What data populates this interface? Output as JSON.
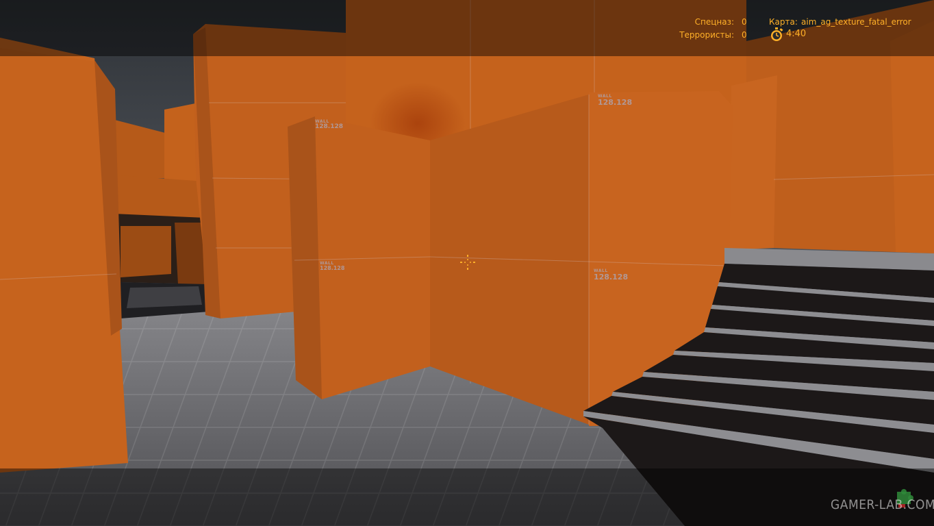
{
  "hud": {
    "ct_label": "Спецназ:",
    "ct_score": "0",
    "t_label": "Террористы:",
    "t_score": "0",
    "map_label": "Карта:",
    "map_name": "aim_ag_texture_fatal_error",
    "timer": "4:40",
    "timer_icon": "stopwatch-icon",
    "accent_color": "#ffb028"
  },
  "scene": {
    "texture_label_small": "WALL",
    "texture_label": "128.128",
    "wall_color": "#c0601c",
    "floor_color": "#6e6e72",
    "sky_color": "#35383d"
  },
  "watermark": {
    "text": "GAMER-LAB.COM",
    "icon": "puzzle-logo-icon"
  }
}
